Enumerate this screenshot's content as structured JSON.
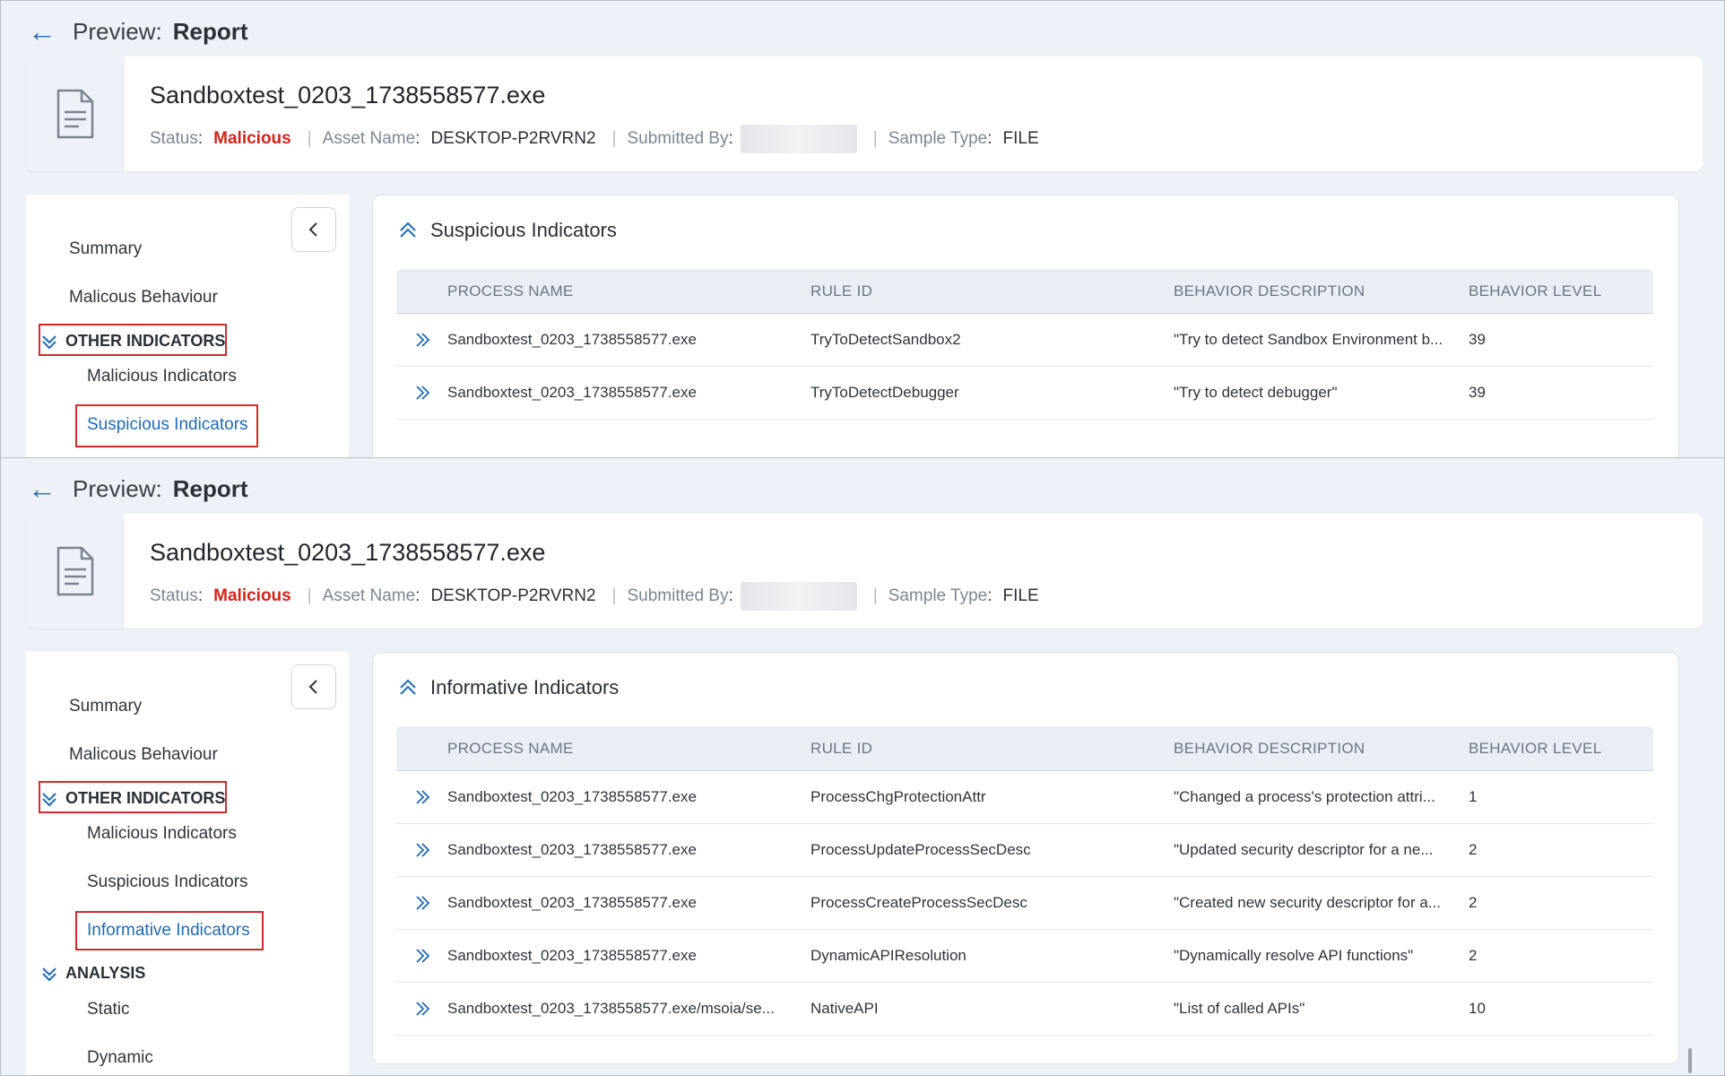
{
  "panels": [
    {
      "header": {
        "preview_label": "Preview:",
        "report_label": "Report"
      },
      "file": {
        "name": "Sandboxtest_0203_1738558577.exe",
        "status_key": "Status",
        "status_value": "Malicious",
        "asset_key": "Asset Name",
        "asset_value": "DESKTOP-P2RVRN2",
        "submitted_key": "Submitted By",
        "sample_key": "Sample Type",
        "sample_value": "FILE"
      },
      "sidebar": {
        "summary": "Summary",
        "malicious_behaviour": "Malicous Behaviour",
        "other_indicators": "OTHER INDICATORS",
        "malicious_indicators": "Malicious Indicators",
        "suspicious_indicators": "Suspicious Indicators"
      },
      "section": {
        "title": "Suspicious Indicators",
        "columns": [
          "PROCESS NAME",
          "RULE ID",
          "BEHAVIOR DESCRIPTION",
          "BEHAVIOR LEVEL"
        ],
        "rows": [
          {
            "process": "Sandboxtest_0203_1738558577.exe",
            "rule": "TryToDetectSandbox2",
            "description": "\"Try to detect Sandbox Environment b...",
            "level": "39"
          },
          {
            "process": "Sandboxtest_0203_1738558577.exe",
            "rule": "TryToDetectDebugger",
            "description": "\"Try to detect debugger\"",
            "level": "39"
          }
        ]
      }
    },
    {
      "header": {
        "preview_label": "Preview:",
        "report_label": "Report"
      },
      "file": {
        "name": "Sandboxtest_0203_1738558577.exe",
        "status_key": "Status",
        "status_value": "Malicious",
        "asset_key": "Asset Name",
        "asset_value": "DESKTOP-P2RVRN2",
        "submitted_key": "Submitted By",
        "sample_key": "Sample Type",
        "sample_value": "FILE"
      },
      "sidebar": {
        "summary": "Summary",
        "malicious_behaviour": "Malicous Behaviour",
        "other_indicators": "OTHER INDICATORS",
        "malicious_indicators": "Malicious Indicators",
        "suspicious_indicators": "Suspicious Indicators",
        "informative_indicators": "Informative Indicators",
        "analysis": "ANALYSIS",
        "static": "Static",
        "dynamic": "Dynamic"
      },
      "section": {
        "title": "Informative Indicators",
        "columns": [
          "PROCESS NAME",
          "RULE ID",
          "BEHAVIOR DESCRIPTION",
          "BEHAVIOR LEVEL"
        ],
        "rows": [
          {
            "process": "Sandboxtest_0203_1738558577.exe",
            "rule": "ProcessChgProtectionAttr",
            "description": "\"Changed a process's protection attri...",
            "level": "1"
          },
          {
            "process": "Sandboxtest_0203_1738558577.exe",
            "rule": "ProcessUpdateProcessSecDesc",
            "description": "\"Updated security descriptor for a ne...",
            "level": "2"
          },
          {
            "process": "Sandboxtest_0203_1738558577.exe",
            "rule": "ProcessCreateProcessSecDesc",
            "description": "\"Created new security descriptor for a...",
            "level": "2"
          },
          {
            "process": "Sandboxtest_0203_1738558577.exe",
            "rule": "DynamicAPIResolution",
            "description": "\"Dynamically resolve API functions\"",
            "level": "2"
          },
          {
            "process": "Sandboxtest_0203_1738558577.exe/msoia/se...",
            "rule": "NativeAPI",
            "description": "\"List of called APIs\"",
            "level": "10"
          }
        ]
      }
    }
  ],
  "colors": {
    "accent": "#1e6ab8",
    "malicious": "#d3231a",
    "highlight_box": "#d52a2a"
  },
  "icons": [
    "back-arrow-icon",
    "file-document-icon",
    "chevron-left-icon",
    "double-chevron-down-icon",
    "double-chevron-up-icon",
    "double-chevron-right-icon"
  ]
}
